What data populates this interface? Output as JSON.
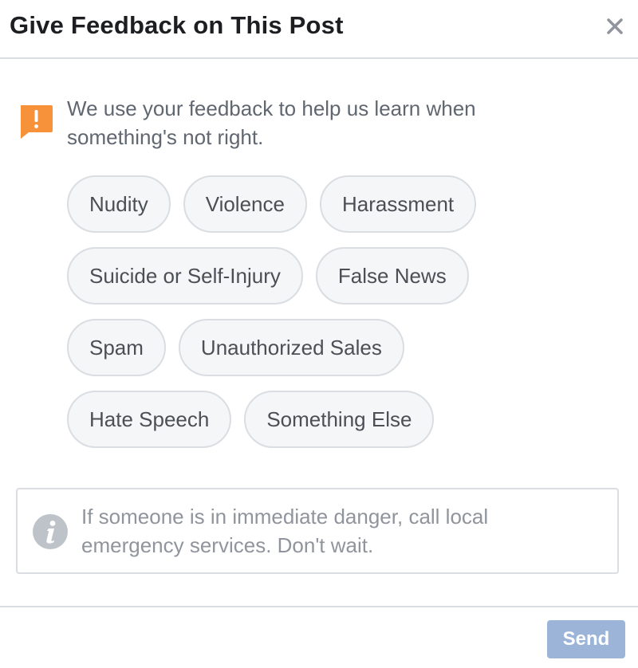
{
  "dialog": {
    "title": "Give Feedback on This Post",
    "close_icon": "close-icon"
  },
  "notice": {
    "icon": "alert-icon",
    "text": "We use your feedback to help us learn when something's not right."
  },
  "options": [
    [
      "Nudity",
      "Violence",
      "Harassment"
    ],
    [
      "Suicide or Self-Injury",
      "False News"
    ],
    [
      "Spam",
      "Unauthorized Sales"
    ],
    [
      "Hate Speech",
      "Something Else"
    ]
  ],
  "info": {
    "icon": "info-icon",
    "text": "If someone is in immediate danger, call local emergency services. Don't wait."
  },
  "footer": {
    "send_label": "Send",
    "send_disabled": true
  },
  "colors": {
    "alert_orange": "#f7923b",
    "info_gray": "#bec2c9",
    "send_disabled_blue": "#9cb4d8",
    "border": "#dadde1"
  }
}
